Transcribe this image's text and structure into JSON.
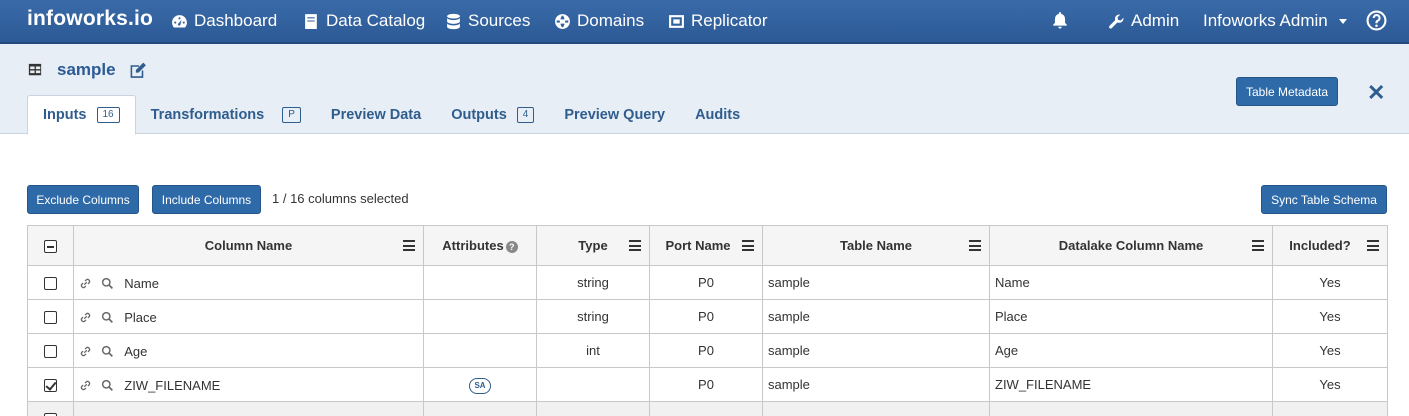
{
  "nav": {
    "brand": "infoworks.io",
    "items": [
      {
        "label": "Dashboard",
        "icon": "dashboard-icon"
      },
      {
        "label": "Data Catalog",
        "icon": "book-icon"
      },
      {
        "label": "Sources",
        "icon": "database-icon"
      },
      {
        "label": "Domains",
        "icon": "globe-icon"
      },
      {
        "label": "Replicator",
        "icon": "replicator-icon"
      }
    ],
    "admin": "Admin",
    "user": "Infoworks Admin"
  },
  "header": {
    "title": "sample",
    "table_metadata_button": "Table Metadata"
  },
  "tabs": [
    {
      "label": "Inputs",
      "badge": "16"
    },
    {
      "label": "Transformations",
      "badge": "P"
    },
    {
      "label": "Preview Data",
      "badge": ""
    },
    {
      "label": "Outputs",
      "badge": "4"
    },
    {
      "label": "Preview Query",
      "badge": ""
    },
    {
      "label": "Audits",
      "badge": ""
    }
  ],
  "actions": {
    "exclude": "Exclude Columns",
    "include": "Include Columns",
    "selection": "1 / 16 columns selected",
    "sync": "Sync Table Schema"
  },
  "table": {
    "headers": {
      "column_name": "Column Name",
      "attributes": "Attributes",
      "type": "Type",
      "port_name": "Port Name",
      "table_name": "Table Name",
      "datalake_column_name": "Datalake Column Name",
      "included": "Included?"
    },
    "rows": [
      {
        "name": "Name",
        "attr": "",
        "type": "string",
        "port": "P0",
        "table": "sample",
        "datalake": "Name",
        "included": "Yes",
        "checked": false
      },
      {
        "name": "Place",
        "attr": "",
        "type": "string",
        "port": "P0",
        "table": "sample",
        "datalake": "Place",
        "included": "Yes",
        "checked": false
      },
      {
        "name": "Age",
        "attr": "",
        "type": "int",
        "port": "P0",
        "table": "sample",
        "datalake": "Age",
        "included": "Yes",
        "checked": false
      },
      {
        "name": "ZIW_FILENAME",
        "attr": "SA",
        "type": "",
        "port": "P0",
        "table": "sample",
        "datalake": "ZIW_FILENAME",
        "included": "Yes",
        "checked": true
      }
    ]
  },
  "colors": {
    "nav_bg": "#2b5a96",
    "accent": "#2f6aa8",
    "subheader_bg": "#e8eef5"
  }
}
